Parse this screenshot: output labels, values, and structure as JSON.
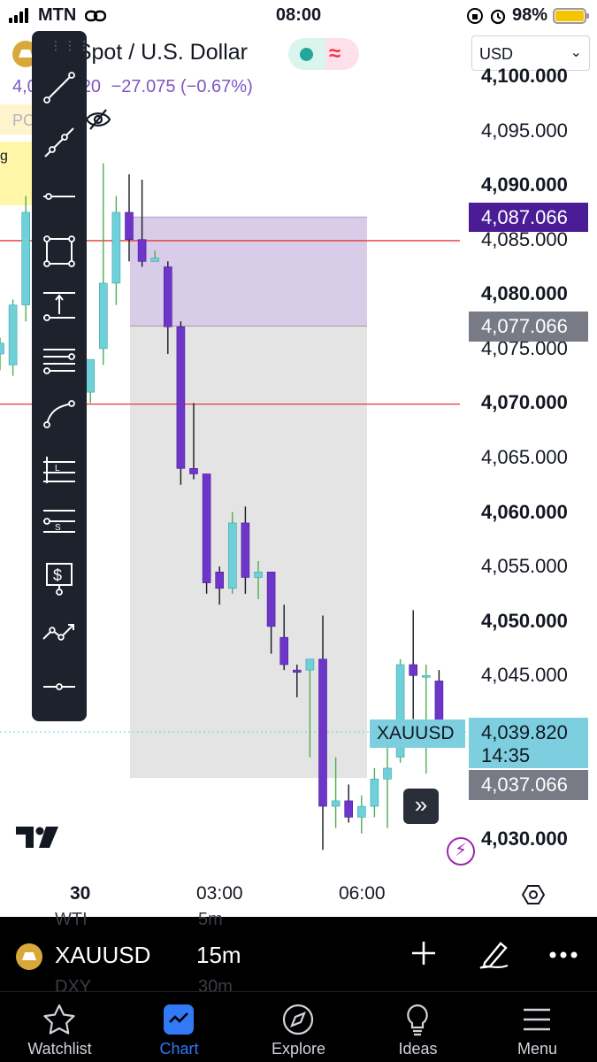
{
  "status_bar": {
    "carrier": "MTN",
    "time": "08:00",
    "battery": "98%"
  },
  "header": {
    "title": "d Spot / U.S. Dollar",
    "currency": "USD",
    "price_partial": "4,0",
    "price_partial_tail": "20",
    "change": "−27.075 (−0.67%)",
    "pc_label": "PC",
    "note_label": "g"
  },
  "chart": {
    "symbol_tag": "XAUUSD",
    "current_price": "4,039.820",
    "countdown": "14:35",
    "badge_upper": "4,087.066",
    "badge_lower_upper": "4,077.066",
    "badge_lower": "4,037.066",
    "y_ticks": [
      {
        "label": "4,100.000",
        "bold": true
      },
      {
        "label": "4,095.000",
        "bold": false
      },
      {
        "label": "4,090.000",
        "bold": true
      },
      {
        "label": "4,085.000",
        "bold": false
      },
      {
        "label": "4,080.000",
        "bold": true
      },
      {
        "label": "4,075.000",
        "bold": false
      },
      {
        "label": "4,070.000",
        "bold": true
      },
      {
        "label": "4,065.000",
        "bold": false
      },
      {
        "label": "4,060.000",
        "bold": true
      },
      {
        "label": "4,055.000",
        "bold": false
      },
      {
        "label": "4,050.000",
        "bold": true
      },
      {
        "label": "4,045.000",
        "bold": false
      },
      {
        "label": "4,040.000",
        "bold": true
      },
      {
        "label": "4,035.000",
        "bold": false
      },
      {
        "label": "4,030.000",
        "bold": true
      }
    ],
    "x_labels": [
      "30",
      "03:00",
      "06:00"
    ],
    "colors": {
      "up": "#6fd0d8",
      "down": "#6e35c9",
      "up_wick": "#4caf50",
      "down_wick": "#131722",
      "hline": "#e53935",
      "profit_zone": "#d8cce8",
      "loss_zone": "#e4e4e4"
    }
  },
  "chart_data": {
    "type": "candlestick",
    "symbol": "XAUUSD",
    "interval": "15m",
    "ylim": [
      4028.5,
      4101
    ],
    "y_ticks": [
      4100,
      4095,
      4090,
      4085,
      4080,
      4075,
      4070,
      4065,
      4060,
      4055,
      4050,
      4045,
      4040,
      4035,
      4030
    ],
    "horizontal_lines": [
      4084.9,
      4069.9
    ],
    "position": {
      "entry": 4077.066,
      "target": 4087.066,
      "stop": 4037.066
    },
    "candles": [
      {
        "o": 4074.5,
        "h": 4076.0,
        "l": 4073.0,
        "c": 4075.5
      },
      {
        "o": 4073.5,
        "h": 4079.5,
        "l": 4072.5,
        "c": 4079.0
      },
      {
        "o": 4079.0,
        "h": 4089.0,
        "l": 4077.5,
        "c": 4087.5
      },
      {
        "o": 4079.5,
        "h": 4081.0,
        "l": 4074.0,
        "c": 4075.5
      },
      {
        "o": 4081.5,
        "h": 4082.5,
        "l": 4073.0,
        "c": 4075.5
      },
      {
        "o": 4073.5,
        "h": 4075.0,
        "l": 4065.0,
        "c": 4066.5
      },
      {
        "o": 4066.5,
        "h": 4073.0,
        "l": 4065.0,
        "c": 4072.5
      },
      {
        "o": 4071.0,
        "h": 4073.5,
        "l": 4070.0,
        "c": 4074.0
      },
      {
        "o": 4075.0,
        "h": 4092.0,
        "l": 4073.5,
        "c": 4081.0
      },
      {
        "o": 4081.0,
        "h": 4089.0,
        "l": 4079.0,
        "c": 4087.5
      },
      {
        "o": 4087.5,
        "h": 4091.0,
        "l": 4083.0,
        "c": 4085.0
      },
      {
        "o": 4085.0,
        "h": 4090.5,
        "l": 4082.5,
        "c": 4083.0
      },
      {
        "o": 4083.0,
        "h": 4084.0,
        "l": 4083.0,
        "c": 4083.3
      },
      {
        "o": 4082.5,
        "h": 4083.0,
        "l": 4074.5,
        "c": 4077.0
      },
      {
        "o": 4077.0,
        "h": 4077.5,
        "l": 4062.5,
        "c": 4064.0
      },
      {
        "o": 4064.0,
        "h": 4070.0,
        "l": 4063.0,
        "c": 4063.5
      },
      {
        "o": 4063.5,
        "h": 4063.5,
        "l": 4052.5,
        "c": 4053.5
      },
      {
        "o": 4054.5,
        "h": 4055.0,
        "l": 4051.5,
        "c": 4053.0
      },
      {
        "o": 4053.0,
        "h": 4060.0,
        "l": 4052.5,
        "c": 4059.0
      },
      {
        "o": 4059.0,
        "h": 4060.5,
        "l": 4052.5,
        "c": 4054.0
      },
      {
        "o": 4054.0,
        "h": 4055.5,
        "l": 4052.0,
        "c": 4054.5
      },
      {
        "o": 4054.5,
        "h": 4054.5,
        "l": 4047.0,
        "c": 4049.5
      },
      {
        "o": 4048.5,
        "h": 4051.5,
        "l": 4045.5,
        "c": 4046.0
      },
      {
        "o": 4045.5,
        "h": 4046.0,
        "l": 4043.0,
        "c": 4045.3
      },
      {
        "o": 4045.5,
        "h": 4046.5,
        "l": 4037.5,
        "c": 4046.5
      },
      {
        "o": 4046.5,
        "h": 4050.5,
        "l": 4029.0,
        "c": 4033.0
      },
      {
        "o": 4033.0,
        "h": 4037.5,
        "l": 4031.0,
        "c": 4033.5
      },
      {
        "o": 4033.5,
        "h": 4035.0,
        "l": 4031.5,
        "c": 4032.0
      },
      {
        "o": 4032.0,
        "h": 4034.0,
        "l": 4030.5,
        "c": 4033.0
      },
      {
        "o": 4033.0,
        "h": 4036.5,
        "l": 4032.0,
        "c": 4035.5
      },
      {
        "o": 4035.5,
        "h": 4039.0,
        "l": 4031.0,
        "c": 4036.5
      },
      {
        "o": 4037.5,
        "h": 4046.5,
        "l": 4037.0,
        "c": 4046.0
      },
      {
        "o": 4046.0,
        "h": 4051.0,
        "l": 4041.0,
        "c": 4045.0
      },
      {
        "o": 4045.0,
        "h": 4046.0,
        "l": 4036.0,
        "c": 4045.0
      },
      {
        "o": 4044.5,
        "h": 4045.5,
        "l": 4039.0,
        "c": 4040.0
      }
    ]
  },
  "drawing_tools": [
    {
      "icon": "trend-line-icon"
    },
    {
      "icon": "ray-icon"
    },
    {
      "icon": "horizontal-line-icon"
    },
    {
      "icon": "rectangle-icon"
    },
    {
      "icon": "price-range-icon"
    },
    {
      "icon": "parallel-channel-icon"
    },
    {
      "icon": "curve-icon"
    },
    {
      "icon": "long-position-icon"
    },
    {
      "icon": "short-position-icon"
    },
    {
      "icon": "price-label-icon"
    },
    {
      "icon": "path-icon"
    },
    {
      "icon": "horizontal-ray-icon"
    }
  ],
  "bottom_sheet": {
    "symbol": "XAUUSD",
    "interval": "15m",
    "ghost_above_symbol": "WTI",
    "ghost_above_interval": "5m",
    "ghost_below_symbol": "DXY",
    "ghost_below_interval": "30m"
  },
  "tabs": [
    {
      "label": "Watchlist",
      "icon": "star-icon",
      "active": false
    },
    {
      "label": "Chart",
      "icon": "chart-icon",
      "active": true
    },
    {
      "label": "Explore",
      "icon": "compass-icon",
      "active": false
    },
    {
      "label": "Ideas",
      "icon": "lightbulb-icon",
      "active": false
    },
    {
      "label": "Menu",
      "icon": "hamburger-icon",
      "active": false
    }
  ]
}
